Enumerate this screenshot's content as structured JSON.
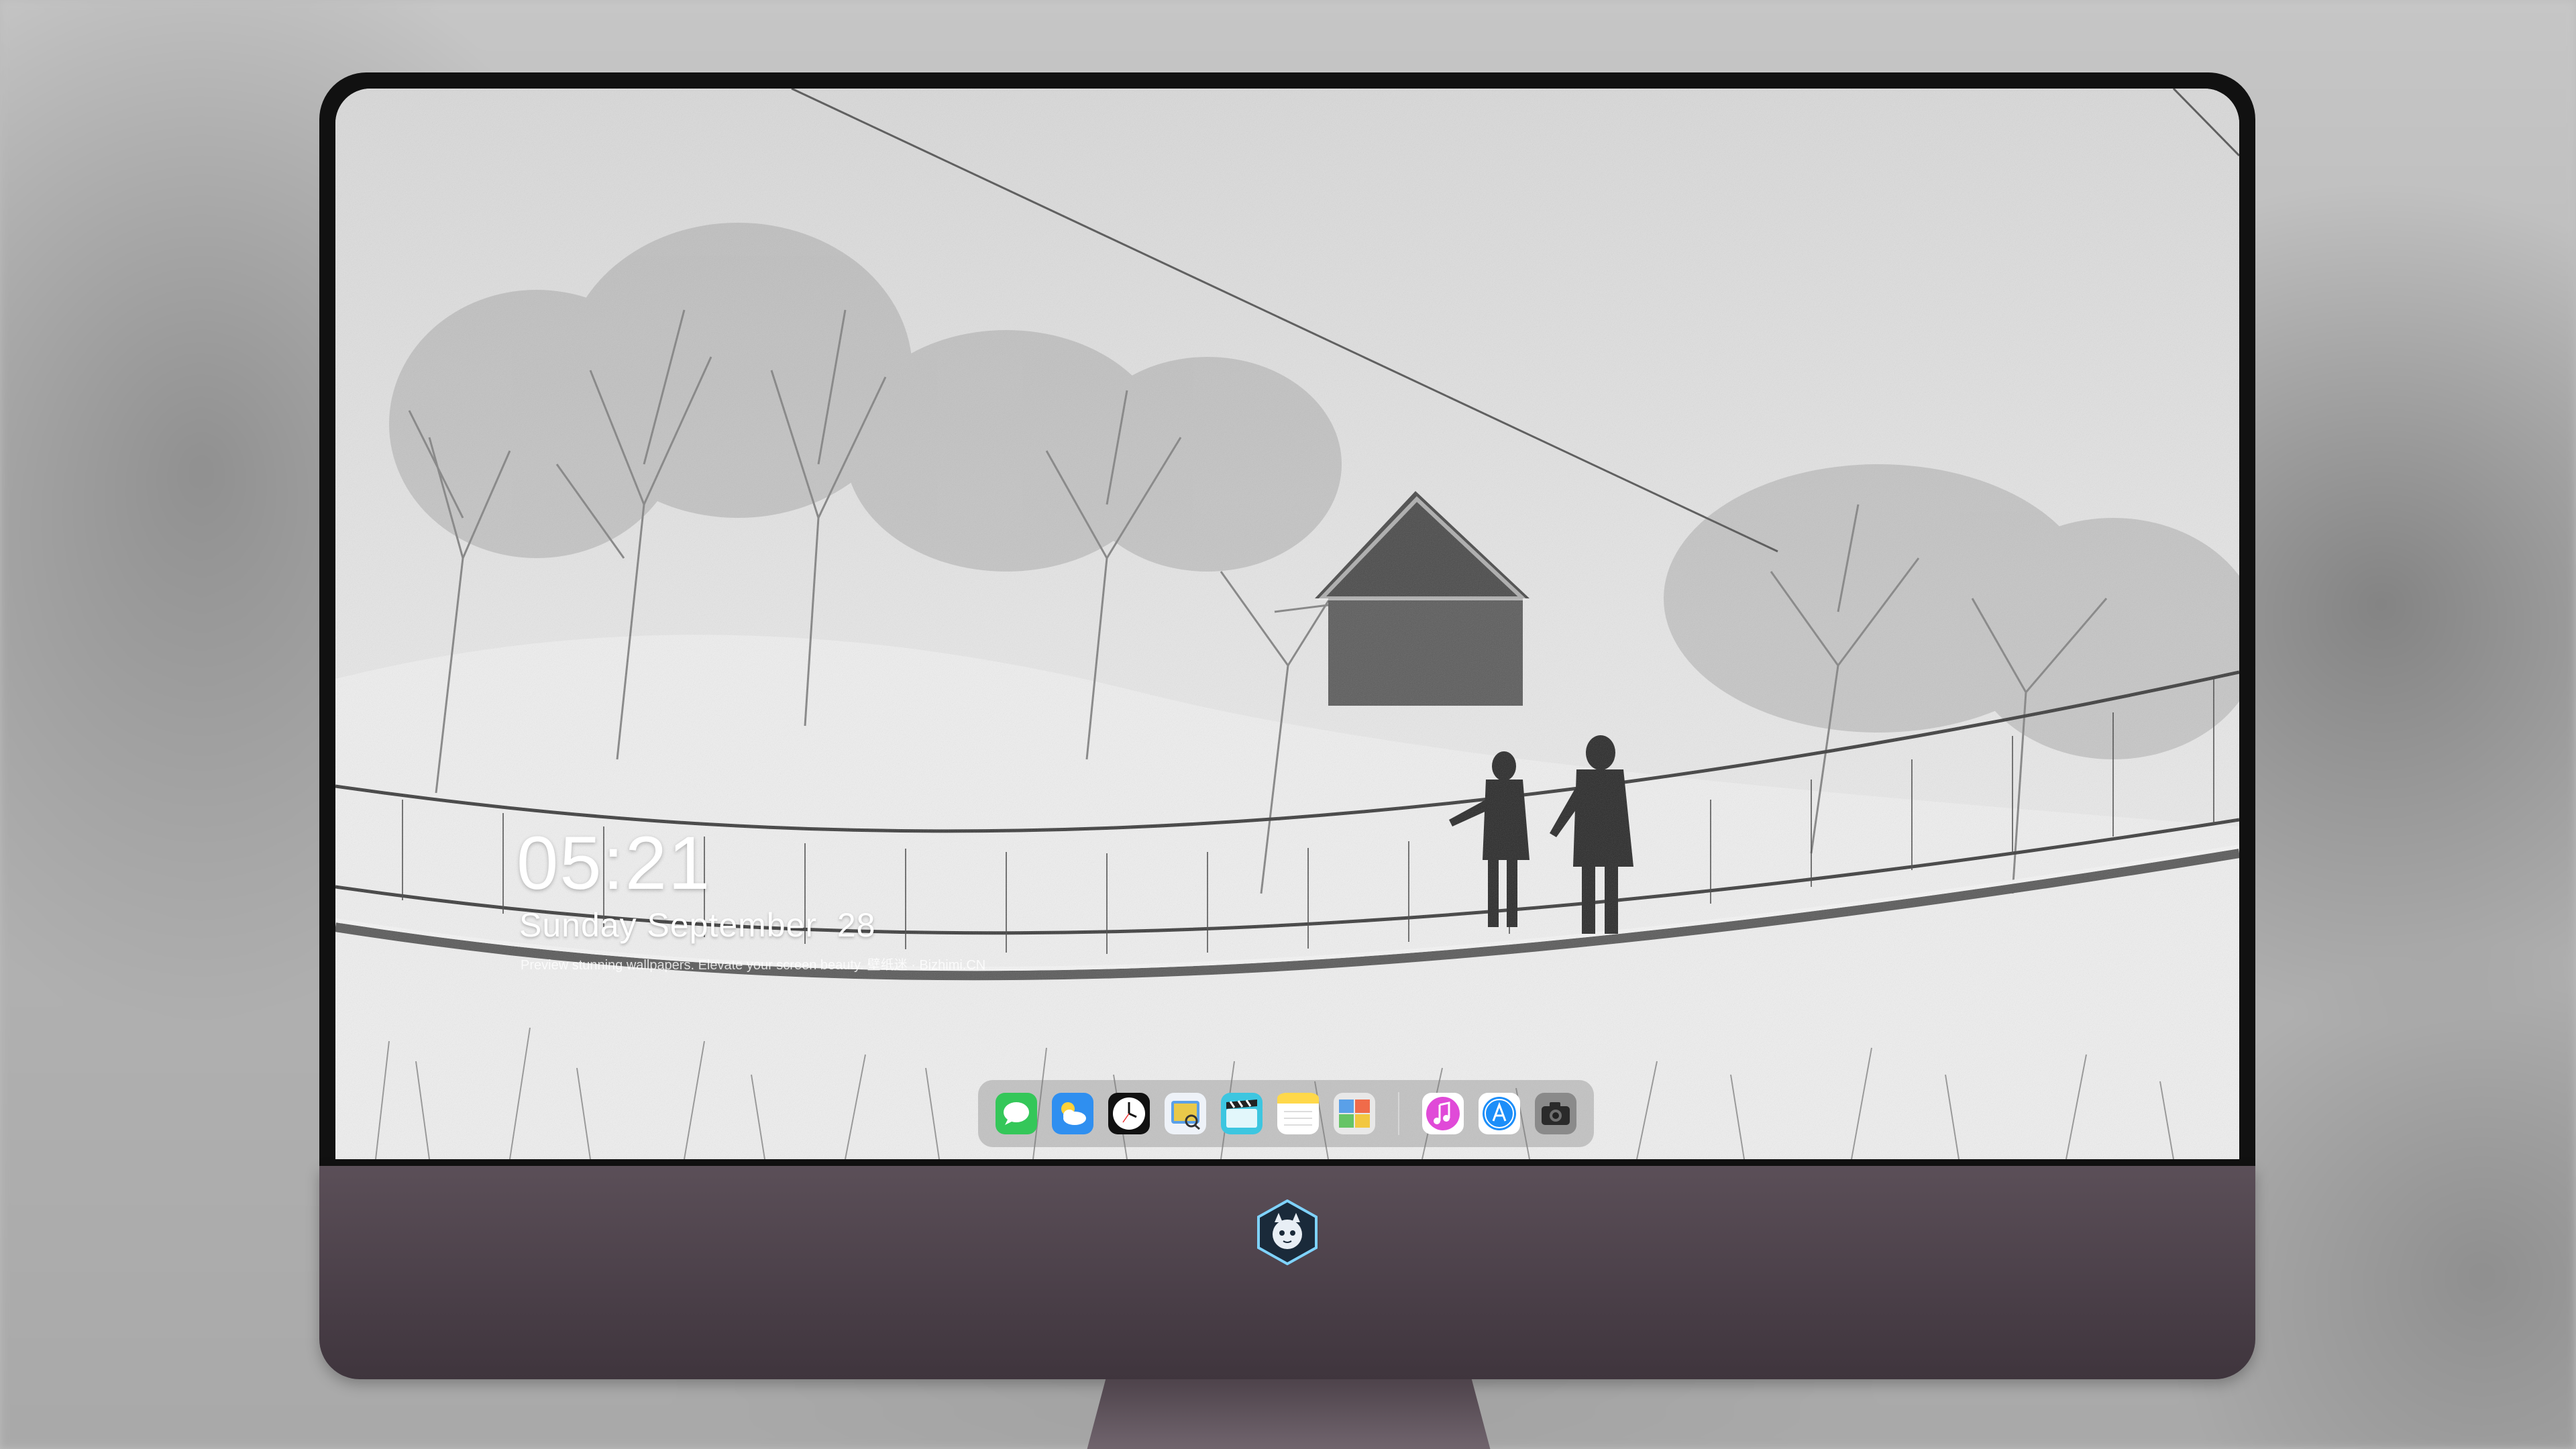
{
  "lockscreen": {
    "time": "05:21",
    "date": "Sunday September  28",
    "tagline": "Preview stunning wallpapers. Elevate your screen beauty. 壁纸迷 · Bizhimi.CN"
  },
  "dock": {
    "apps": [
      {
        "name": "Messages",
        "icon": "messages-icon",
        "color": "#34c759"
      },
      {
        "name": "Weather",
        "icon": "weather-icon",
        "color": "#2f8ff0"
      },
      {
        "name": "Clock",
        "icon": "clock-icon",
        "color": "#111111"
      },
      {
        "name": "Preview",
        "icon": "preview-icon",
        "color": "#e9c94a"
      },
      {
        "name": "Clips",
        "icon": "clips-icon",
        "color": "#3dc6e0"
      },
      {
        "name": "Notes",
        "icon": "notes-icon",
        "color": "#ffd84a"
      },
      {
        "name": "Photo Booth",
        "icon": "photo-booth-icon",
        "color": "#5aa0e8"
      },
      {
        "name": "iTunes",
        "icon": "music-icon",
        "color": "#e04ad8"
      },
      {
        "name": "App Store",
        "icon": "app-store-icon",
        "color": "#1c8ef9"
      },
      {
        "name": "Camera",
        "icon": "camera-icon",
        "color": "#6f6f6f"
      }
    ]
  },
  "monitor": {
    "logo": "mascot-logo-icon",
    "chin_color": "#4f444d"
  }
}
